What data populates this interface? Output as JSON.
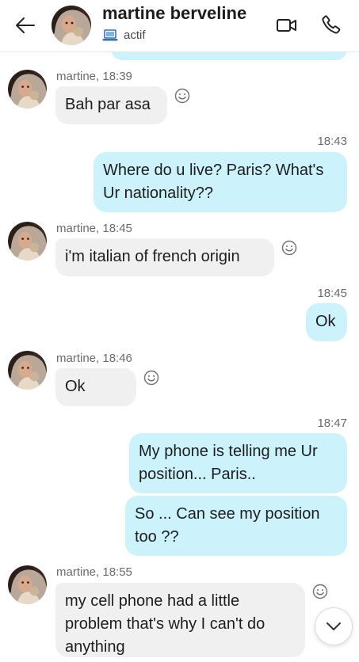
{
  "header": {
    "contact_name": "martine berveline",
    "status_text": "actif"
  },
  "messages": [
    {
      "direction": "in",
      "sender_time": "martine, 18:39",
      "text": "Bah par asa"
    },
    {
      "direction": "out",
      "time": "18:43",
      "text": "Where do u live? Paris? What's Ur nationality??"
    },
    {
      "direction": "in",
      "sender_time": "martine, 18:45",
      "text": "i'm italian of french origin"
    },
    {
      "direction": "out",
      "time": "18:45",
      "text": "Ok"
    },
    {
      "direction": "in",
      "sender_time": "martine, 18:46",
      "text": "Ok"
    },
    {
      "direction": "out",
      "time": "18:47",
      "text": "My phone is telling me Ur position... Paris.."
    },
    {
      "direction": "out",
      "text": "So ... Can see my position too ??"
    },
    {
      "direction": "in",
      "sender_time": "martine, 18:55",
      "text": "my cell phone had a little problem that's why I can't do anything"
    }
  ],
  "icons": {
    "back": "arrow-left-icon",
    "video": "video-camera-icon",
    "call": "phone-icon",
    "status": "laptop-icon",
    "react": "smiley-icon",
    "scroll": "chevron-down-icon"
  },
  "colors": {
    "outgoing_bubble": "#ccf2fc",
    "incoming_bubble": "#f0f0f0",
    "meta_text": "#6b6b6b"
  }
}
